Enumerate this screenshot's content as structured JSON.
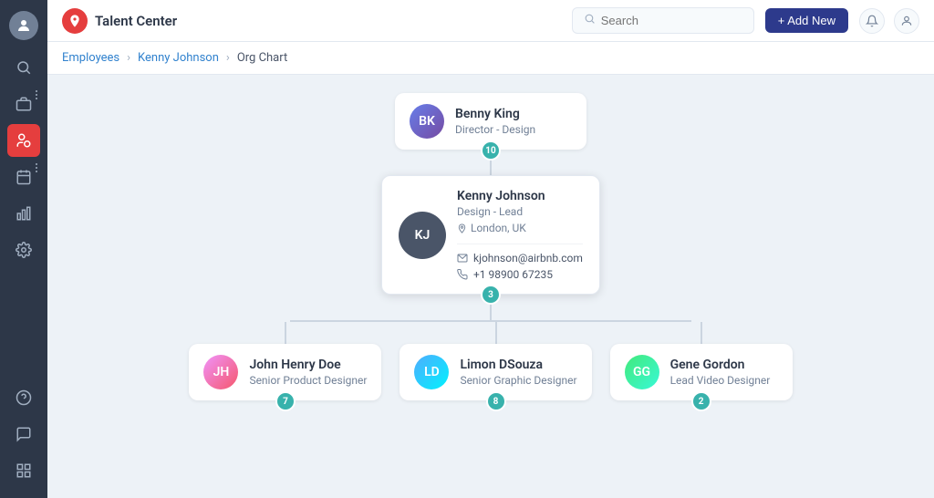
{
  "app": {
    "title": "Talent Center",
    "logo_alt": "Talent Center Logo"
  },
  "topbar": {
    "search_placeholder": "Search",
    "add_new_label": "+ Add New"
  },
  "breadcrumb": {
    "items": [
      {
        "label": "Employees",
        "current": false
      },
      {
        "label": "Kenny Johnson",
        "current": false
      },
      {
        "label": "Org Chart",
        "current": true
      }
    ]
  },
  "sidebar": {
    "icons": [
      {
        "name": "user-icon",
        "symbol": "👤",
        "active": false
      },
      {
        "name": "search-icon",
        "symbol": "🔍",
        "active": false
      },
      {
        "name": "briefcase-icon",
        "symbol": "💼",
        "active": false
      },
      {
        "name": "people-icon",
        "symbol": "👥",
        "active": true
      },
      {
        "name": "calendar-icon",
        "symbol": "📅",
        "active": false
      },
      {
        "name": "chart-icon",
        "symbol": "📊",
        "active": false
      },
      {
        "name": "settings-icon",
        "symbol": "⚙️",
        "active": false
      }
    ],
    "bottom_icons": [
      {
        "name": "help-icon",
        "symbol": "❓"
      },
      {
        "name": "chat-icon",
        "symbol": "💬"
      },
      {
        "name": "grid-icon",
        "symbol": "⠿"
      }
    ]
  },
  "org": {
    "root": {
      "name": "Benny King",
      "role": "Director - Design",
      "badge": 10,
      "avatar_initials": "BK",
      "avatar_class": "av-benny"
    },
    "selected": {
      "name": "Kenny Johnson",
      "role": "Design - Lead",
      "location": "London, UK",
      "email": "kjohnson@airbnb.com",
      "phone": "+1 98900 67235",
      "badge": 3,
      "avatar_initials": "KJ",
      "avatar_class": "av-kenny"
    },
    "children": [
      {
        "name": "John Henry Doe",
        "role": "Senior Product Designer",
        "badge": 7,
        "avatar_initials": "JH",
        "avatar_class": "av-john"
      },
      {
        "name": "Limon DSouza",
        "role": "Senior Graphic Designer",
        "badge": 8,
        "avatar_initials": "LD",
        "avatar_class": "av-limon"
      },
      {
        "name": "Gene Gordon",
        "role": "Lead Video Designer",
        "badge": 2,
        "avatar_initials": "GG",
        "avatar_class": "av-gene"
      }
    ]
  }
}
